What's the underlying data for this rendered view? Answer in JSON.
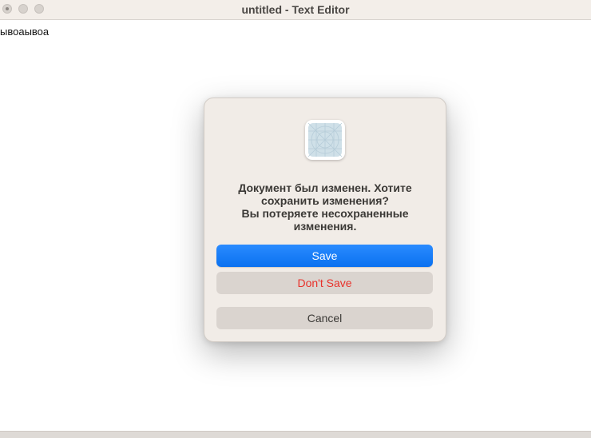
{
  "window": {
    "title": "untitled - Text Editor"
  },
  "editor": {
    "content": "ывоаывоа"
  },
  "dialog": {
    "icon": "text-editor-app-icon",
    "message_lines": [
      "Документ был изменен. Хотите",
      "сохранить изменения?",
      "Вы потеряете несохраненные",
      "изменения."
    ],
    "save_label": "Save",
    "dont_save_label": "Don't Save",
    "cancel_label": "Cancel"
  },
  "colors": {
    "accent": "#0a71f0",
    "destructive": "#e8322b",
    "dialog_background": "#f1ece7"
  }
}
